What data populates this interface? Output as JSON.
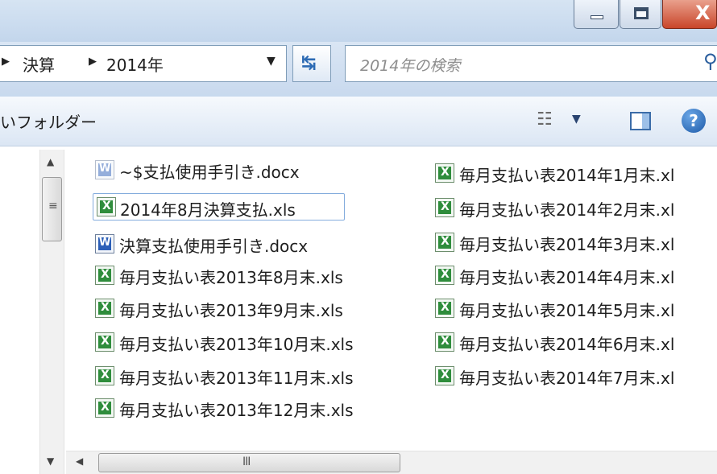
{
  "window": {
    "minimize_glyph": "",
    "maximize_glyph": "",
    "close_glyph": "X"
  },
  "address": {
    "crumbs": [
      "決算",
      "2014年"
    ],
    "search_placeholder": "2014年の検索"
  },
  "command_bar": {
    "folder_label": "いフォルダー"
  },
  "scrollbars": {
    "vertical_grip": "≡",
    "horizontal_grip": "III"
  },
  "files": {
    "column1": [
      {
        "name": "~$支払使用手引き.docx",
        "type": "docx-temp"
      },
      {
        "name": "2014年8月決算支払.xls",
        "type": "xls",
        "selected": true
      },
      {
        "name": "決算支払使用手引き.docx",
        "type": "docx"
      },
      {
        "name": "毎月支払い表2013年8月末.xls",
        "type": "xls"
      },
      {
        "name": "毎月支払い表2013年9月末.xls",
        "type": "xls"
      },
      {
        "name": "毎月支払い表2013年10月末.xls",
        "type": "xls"
      },
      {
        "name": "毎月支払い表2013年11月末.xls",
        "type": "xls"
      },
      {
        "name": "毎月支払い表2013年12月末.xls",
        "type": "xls"
      }
    ],
    "column2": [
      {
        "name": "毎月支払い表2014年1月末.xl",
        "type": "xls"
      },
      {
        "name": "毎月支払い表2014年2月末.xl",
        "type": "xls"
      },
      {
        "name": "毎月支払い表2014年3月末.xl",
        "type": "xls"
      },
      {
        "name": "毎月支払い表2014年4月末.xl",
        "type": "xls"
      },
      {
        "name": "毎月支払い表2014年5月末.xl",
        "type": "xls"
      },
      {
        "name": "毎月支払い表2014年6月末.xl",
        "type": "xls"
      },
      {
        "name": "毎月支払い表2014年7月末.xl",
        "type": "xls"
      }
    ]
  },
  "icons": {
    "crumb_separator": "triangle-right-icon",
    "breadcrumb_dropdown": "chevron-down-icon",
    "refresh": "refresh-icon",
    "search": "search-icon",
    "views": "views-icon",
    "preview_pane": "preview-pane-icon",
    "help": "help-icon",
    "xls": "excel-file-icon",
    "docx": "word-file-icon"
  },
  "colors": {
    "chrome": "#c8d9ee",
    "close_button": "#c9452a",
    "selection_border": "#84acdd",
    "excel": "#2f8d3c",
    "word": "#2c5fb8"
  }
}
